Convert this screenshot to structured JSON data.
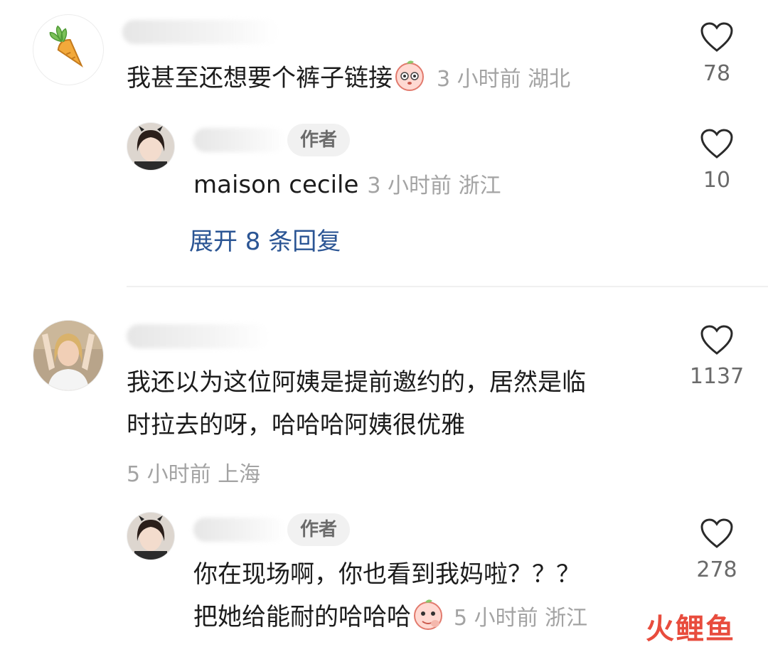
{
  "comments": [
    {
      "content": "我甚至还想要个裤子链接",
      "time": "3 小时前",
      "location": "湖北",
      "likes": "78",
      "avatar": "carrot-avatar",
      "reply": {
        "badge": "作者",
        "content": "maison cecile",
        "time": "3 小时前",
        "location": "浙江",
        "likes": "10",
        "expand_text": "展开 8 条回复"
      }
    },
    {
      "content_line1": "我还以为这位阿姨是提前邀约的，居然是临",
      "content_line2": "时拉去的呀，哈哈哈阿姨很优雅",
      "time": "5 小时前",
      "location": "上海",
      "likes": "1137",
      "reply": {
        "badge": "作者",
        "content_line1": "你在现场啊，你也看到我妈啦？？？",
        "content_line2": "把她给能耐的哈哈哈",
        "time": "5 小时前",
        "location": "浙江",
        "likes": "278"
      }
    }
  ],
  "watermark": "火鲤鱼",
  "colors": {
    "link": "#2b5594",
    "meta": "#a3a3a3",
    "badge_bg": "#f1f1f1"
  },
  "icons": [
    "heart-icon",
    "carrot-icon",
    "peach-emoji"
  ]
}
